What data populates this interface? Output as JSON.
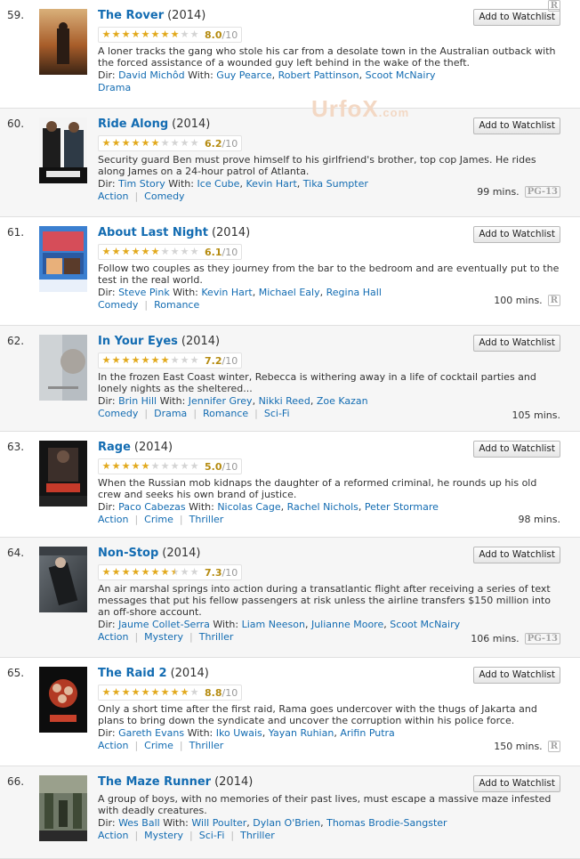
{
  "watermark": "UrfoX",
  "watermark_suffix": ".com",
  "watchlist_label": "Add to Watchlist",
  "rating_outof": "/10",
  "dir_label": "Dir:",
  "with_label": "With:",
  "accent": "#136cb2",
  "star_color": "#e2a91c",
  "movies": [
    {
      "num": "59.",
      "title": "The Rover",
      "year": "(2014)",
      "rating": "8.0",
      "stars": 8,
      "plot": "A loner tracks the gang who stole his car from a desolate town in the Australian outback with the forced assistance of a wounded guy left behind in the wake of the theft.",
      "director": "David Michôd",
      "cast": [
        "Guy Pearce",
        "Robert Pattinson",
        "Scoot McNairy"
      ],
      "genres": [
        "Drama"
      ],
      "runtime": "",
      "cert": "R",
      "poster": "rover-poster"
    },
    {
      "num": "60.",
      "title": "Ride Along",
      "year": "(2014)",
      "rating": "6.2",
      "stars": 6,
      "plot": "Security guard Ben must prove himself to his girlfriend's brother, top cop James. He rides along James on a 24-hour patrol of Atlanta.",
      "director": "Tim Story",
      "cast": [
        "Ice Cube",
        "Kevin Hart",
        "Tika Sumpter"
      ],
      "genres": [
        "Action",
        "Comedy"
      ],
      "runtime": "99 mins.",
      "cert": "PG-13",
      "poster": "ride-along-poster"
    },
    {
      "num": "61.",
      "title": "About Last Night",
      "year": "(2014)",
      "rating": "6.1",
      "stars": 6,
      "plot": "Follow two couples as they journey from the bar to the bedroom and are eventually put to the test in the real world.",
      "director": "Steve Pink",
      "cast": [
        "Kevin Hart",
        "Michael Ealy",
        "Regina Hall"
      ],
      "genres": [
        "Comedy",
        "Romance"
      ],
      "runtime": "100 mins.",
      "cert": "R",
      "poster": "about-last-night-poster"
    },
    {
      "num": "62.",
      "title": "In Your Eyes",
      "year": "(2014)",
      "rating": "7.2",
      "stars": 7,
      "plot": "In the frozen East Coast winter, Rebecca is withering away in a life of cocktail parties and lonely nights as the sheltered...",
      "director": "Brin Hill",
      "cast": [
        "Jennifer Grey",
        "Nikki Reed",
        "Zoe Kazan"
      ],
      "genres": [
        "Comedy",
        "Drama",
        "Romance",
        "Sci-Fi"
      ],
      "runtime": "105 mins.",
      "cert": "",
      "poster": "in-your-eyes-poster"
    },
    {
      "num": "63.",
      "title": "Rage",
      "year": "(2014)",
      "rating": "5.0",
      "stars": 5,
      "plot": "When the Russian mob kidnaps the daughter of a reformed criminal, he rounds up his old crew and seeks his own brand of justice.",
      "director": "Paco Cabezas",
      "cast": [
        "Nicolas Cage",
        "Rachel Nichols",
        "Peter Stormare"
      ],
      "genres": [
        "Action",
        "Crime",
        "Thriller"
      ],
      "runtime": "98 mins.",
      "cert": "",
      "poster": "rage-poster"
    },
    {
      "num": "64.",
      "title": "Non-Stop",
      "year": "(2014)",
      "rating": "7.3",
      "stars": 7.5,
      "plot": "An air marshal springs into action during a transatlantic flight after receiving a series of text messages that put his fellow passengers at risk unless the airline transfers $150 million into an off-shore account.",
      "director": "Jaume Collet-Serra",
      "cast": [
        "Liam Neeson",
        "Julianne Moore",
        "Scoot McNairy"
      ],
      "genres": [
        "Action",
        "Mystery",
        "Thriller"
      ],
      "runtime": "106 mins.",
      "cert": "PG-13",
      "poster": "non-stop-poster"
    },
    {
      "num": "65.",
      "title": "The Raid 2",
      "year": "(2014)",
      "rating": "8.8",
      "stars": 9,
      "plot": "Only a short time after the first raid, Rama goes undercover with the thugs of Jakarta and plans to bring down the syndicate and uncover the corruption within his police force.",
      "director": "Gareth Evans",
      "cast": [
        "Iko Uwais",
        "Yayan Ruhian",
        "Arifin Putra"
      ],
      "genres": [
        "Action",
        "Crime",
        "Thriller"
      ],
      "runtime": "150 mins.",
      "cert": "R",
      "poster": "raid-2-poster"
    },
    {
      "num": "66.",
      "title": "The Maze Runner",
      "year": "(2014)",
      "rating": "",
      "stars": 0,
      "plot": "A group of boys, with no memories of their past lives, must escape a massive maze infested with deadly creatures.",
      "director": "Wes Ball",
      "cast": [
        "Will Poulter",
        "Dylan O'Brien",
        "Thomas Brodie-Sangster"
      ],
      "genres": [
        "Action",
        "Mystery",
        "Sci-Fi",
        "Thriller"
      ],
      "runtime": "",
      "cert": "",
      "poster": "maze-runner-poster"
    }
  ]
}
